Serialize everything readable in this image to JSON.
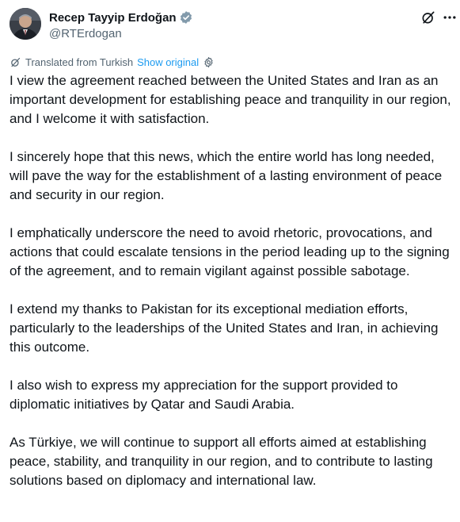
{
  "author": {
    "display_name": "Recep Tayyip Erdoğan",
    "handle": "@RTErdogan",
    "verified_color": "#829aab"
  },
  "actions": {
    "grok_icon": "grok-icon",
    "more_icon": "more-icon"
  },
  "translation": {
    "label": "Translated from Turkish",
    "show_original": "Show original",
    "link_color": "#1d9bf0"
  },
  "tweet": {
    "paragraphs": [
      "I view the agreement reached between the United States and Iran as an important development for establishing peace and tranquility in our region, and I welcome it with satisfaction.",
      "I sincerely hope that this news, which the entire world has long needed, will pave the way for the establishment of a lasting environment of peace and security in our region.",
      "I emphatically underscore the need to avoid rhetoric, provocations, and actions that could escalate tensions in the period leading up to the signing of the agreement, and to remain vigilant against possible sabotage.",
      "I extend my thanks to Pakistan for its exceptional mediation efforts, particularly to the leaderships of the United States and Iran, in achieving this outcome.",
      "I also wish to express my appreciation for the support provided to diplomatic initiatives by Qatar and Saudi Arabia.",
      "As Türkiye, we will continue to support all efforts aimed at establishing peace, stability, and tranquility in our region, and to contribute to lasting solutions based on diplomacy and international law."
    ]
  }
}
